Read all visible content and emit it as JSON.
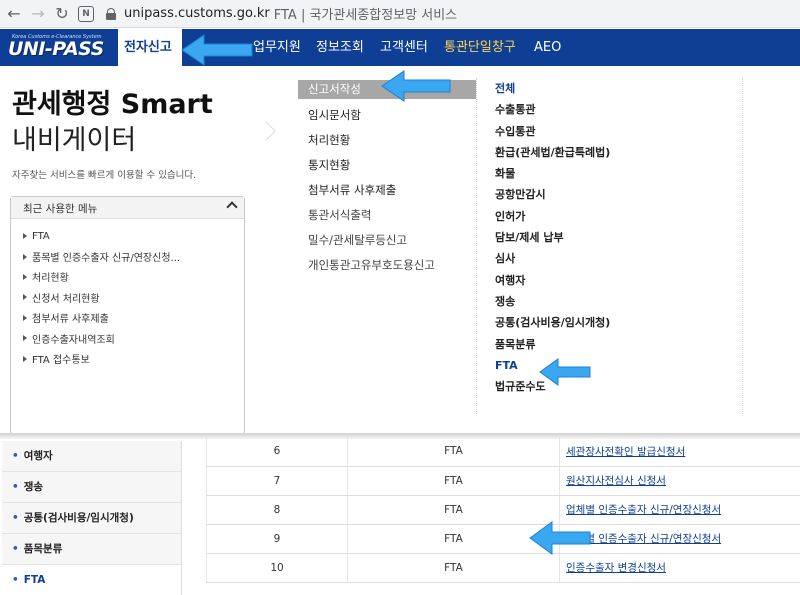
{
  "browser": {
    "url_host": "unipass.customs.go.kr",
    "url_rest": "FTA | 국가관세종합정보망 서비스",
    "ext_label": "N"
  },
  "header": {
    "logo_small": "Korea Customs e-Clearance System",
    "logo_main": "UNI-PASS",
    "nav": [
      {
        "label": "전자신고"
      },
      {
        "label": "업무지원"
      },
      {
        "label": "정보조회"
      },
      {
        "label": "고객센터"
      },
      {
        "label": "통관단일창구"
      },
      {
        "label": "AEO"
      }
    ]
  },
  "mega": {
    "title": "관세행정 Smart",
    "subtitle": "내비게이터",
    "description": "자주찾는 서비스를 빠르게 이용할 수 있습니다.",
    "recent": {
      "heading": "최근 사용한 메뉴",
      "items": [
        "FTA",
        "품목별 인증수출자 신규/연장신청...",
        "처리현황",
        "신청서 처리현황",
        "첨부서류 사후제출",
        "인증수출자내역조회",
        "FTA 접수통보"
      ]
    },
    "menu": [
      "신고서작성",
      "임시문서함",
      "처리현황",
      "통지현황",
      "첨부서류 사후제출",
      "통관서식출력",
      "밀수/관세탈루등신고",
      "개인통관고유부호도용신고"
    ],
    "submenu": [
      "전체",
      "수출통관",
      "수입통관",
      "환급(관세법/환급특례법)",
      "화물",
      "공항만감시",
      "인허가",
      "담보/제세 납부",
      "심사",
      "여행자",
      "쟁송",
      "공통(검사비용/임시개청)",
      "품목분류",
      "FTA",
      "법규준수도"
    ]
  },
  "left_nav": [
    "여행자",
    "쟁송",
    "공통(검사비용/임시개청)",
    "품목분류",
    "FTA"
  ],
  "table": {
    "rows": [
      {
        "no": "6",
        "category": "FTA",
        "title": "세관장사전확인 발급신청서"
      },
      {
        "no": "7",
        "category": "FTA",
        "title": "원산지사전심사 신청서"
      },
      {
        "no": "8",
        "category": "FTA",
        "title": "업체별 인증수출자 신규/연장신청서"
      },
      {
        "no": "9",
        "category": "FTA",
        "title": "품목별 인증수출자 신규/연장신청서"
      },
      {
        "no": "10",
        "category": "FTA",
        "title": "인증수출자 변경신청서"
      }
    ]
  },
  "colors": {
    "header_bg": "#0f3f95",
    "accent_link": "#0f3f95",
    "annotation_arrow": "#39a8f0"
  }
}
